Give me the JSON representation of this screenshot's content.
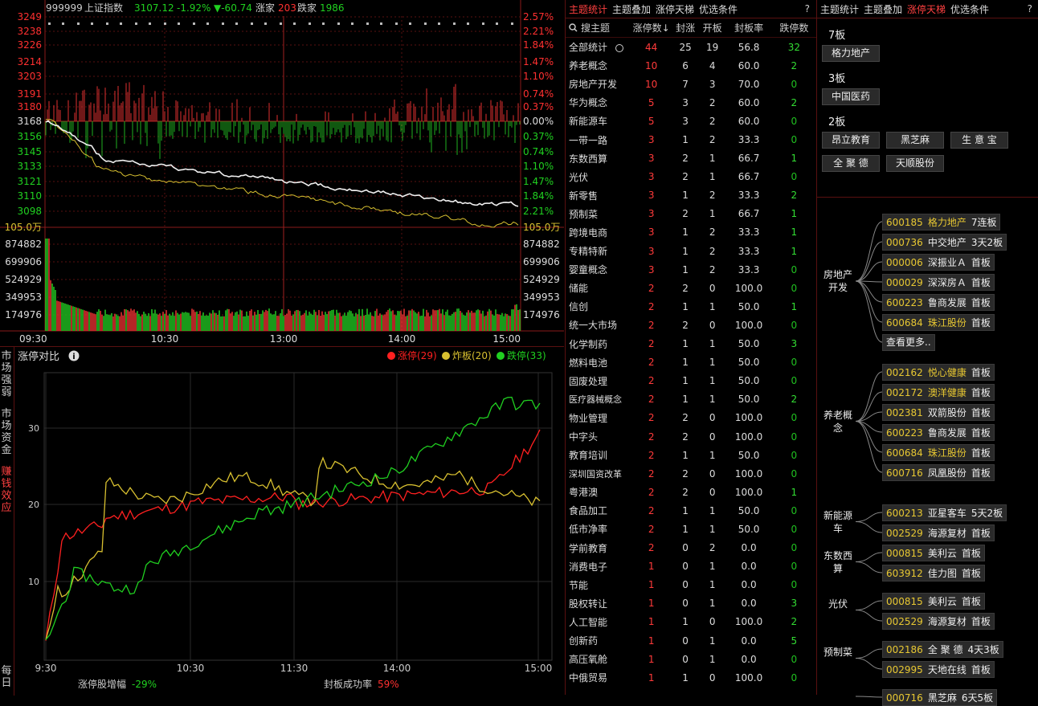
{
  "index_header": {
    "code": "999999",
    "name": "上证指数",
    "price": "3107.12",
    "pct": "-1.92%",
    "change": "▼-60.74",
    "up_label": "涨家",
    "up_count": "203",
    "down_label": "跌家",
    "down_count": "1986"
  },
  "price_axis": {
    "left": [
      "3249",
      "3238",
      "3226",
      "3214",
      "3203",
      "3191",
      "3180",
      "3168",
      "3156",
      "3145",
      "3133",
      "3121",
      "3110",
      "3098"
    ],
    "right": [
      "2.57%",
      "2.21%",
      "1.84%",
      "1.47%",
      "1.10%",
      "0.74%",
      "0.37%",
      "0.00%",
      "0.37%",
      "0.74%",
      "1.10%",
      "1.47%",
      "1.84%",
      "2.21%"
    ]
  },
  "volume_axis": {
    "unit": "105.0万",
    "left": [
      "874882",
      "699906",
      "524929",
      "349953",
      "174976"
    ],
    "right": [
      "874882",
      "699906",
      "524929",
      "349953",
      "174976"
    ]
  },
  "time_axis": [
    "09:30",
    "10:30",
    "13:00",
    "14:00",
    "15:00"
  ],
  "compare": {
    "title": "涨停对比",
    "legend": [
      {
        "label": "涨停(29)",
        "color": "#ff2020"
      },
      {
        "label": "炸板(20)",
        "color": "#d8c030"
      },
      {
        "label": "跌停(33)",
        "color": "#20d020"
      }
    ],
    "y_ticks": [
      "30",
      "20",
      "10"
    ],
    "x_ticks": [
      "9:30",
      "10:30",
      "11:30",
      "14:00",
      "15:00"
    ],
    "footer_left_label": "涨停股增幅",
    "footer_left_value": "-29%",
    "footer_right_label": "封板成功率",
    "footer_right_value": "59%"
  },
  "side_tabs": [
    {
      "label": "市场强弱",
      "color": "#ccc"
    },
    {
      "label": "市场资金",
      "color": "#ccc"
    },
    {
      "label": "赚钱效应",
      "color": "#ff4040"
    },
    {
      "label": "每日",
      "color": "#ccc"
    }
  ],
  "mid": {
    "tabs": [
      {
        "label": "主题统计",
        "active": true
      },
      {
        "label": "主题叠加",
        "active": false
      },
      {
        "label": "涨停天梯",
        "active": false
      },
      {
        "label": "优选条件",
        "active": false
      }
    ],
    "help": "?",
    "search_label": "搜主题",
    "headers": [
      "涨停数↓",
      "封涨",
      "开板",
      "封板率",
      "跌停数"
    ],
    "rows": [
      [
        "全部统计",
        "44",
        "25",
        "19",
        "56.8",
        "32"
      ],
      [
        "养老概念",
        "10",
        "6",
        "4",
        "60.0",
        "2"
      ],
      [
        "房地产开发",
        "10",
        "7",
        "3",
        "70.0",
        "0"
      ],
      [
        "华为概念",
        "5",
        "3",
        "2",
        "60.0",
        "2"
      ],
      [
        "新能源车",
        "5",
        "3",
        "2",
        "60.0",
        "0"
      ],
      [
        "一带一路",
        "3",
        "1",
        "2",
        "33.3",
        "0"
      ],
      [
        "东数西算",
        "3",
        "2",
        "1",
        "66.7",
        "1"
      ],
      [
        "光伏",
        "3",
        "2",
        "1",
        "66.7",
        "0"
      ],
      [
        "新零售",
        "3",
        "1",
        "2",
        "33.3",
        "2"
      ],
      [
        "预制菜",
        "3",
        "2",
        "1",
        "66.7",
        "1"
      ],
      [
        "跨境电商",
        "3",
        "1",
        "2",
        "33.3",
        "1"
      ],
      [
        "专精特新",
        "3",
        "1",
        "2",
        "33.3",
        "1"
      ],
      [
        "婴童概念",
        "3",
        "1",
        "2",
        "33.3",
        "0"
      ],
      [
        "储能",
        "2",
        "2",
        "0",
        "100.0",
        "0"
      ],
      [
        "信创",
        "2",
        "1",
        "1",
        "50.0",
        "1"
      ],
      [
        "统一大市场",
        "2",
        "2",
        "0",
        "100.0",
        "0"
      ],
      [
        "化学制药",
        "2",
        "1",
        "1",
        "50.0",
        "3"
      ],
      [
        "燃料电池",
        "2",
        "1",
        "1",
        "50.0",
        "0"
      ],
      [
        "固废处理",
        "2",
        "1",
        "1",
        "50.0",
        "0"
      ],
      [
        "医疗器械概念",
        "2",
        "1",
        "1",
        "50.0",
        "2"
      ],
      [
        "物业管理",
        "2",
        "2",
        "0",
        "100.0",
        "0"
      ],
      [
        "中字头",
        "2",
        "2",
        "0",
        "100.0",
        "0"
      ],
      [
        "教育培训",
        "2",
        "1",
        "1",
        "50.0",
        "0"
      ],
      [
        "深圳国资改革",
        "2",
        "2",
        "0",
        "100.0",
        "0"
      ],
      [
        "粤港澳",
        "2",
        "2",
        "0",
        "100.0",
        "1"
      ],
      [
        "食品加工",
        "2",
        "1",
        "1",
        "50.0",
        "0"
      ],
      [
        "低市净率",
        "2",
        "1",
        "1",
        "50.0",
        "0"
      ],
      [
        "学前教育",
        "2",
        "0",
        "2",
        "0.0",
        "0"
      ],
      [
        "消费电子",
        "1",
        "0",
        "1",
        "0.0",
        "0"
      ],
      [
        "节能",
        "1",
        "0",
        "1",
        "0.0",
        "0"
      ],
      [
        "股权转让",
        "1",
        "0",
        "1",
        "0.0",
        "3"
      ],
      [
        "人工智能",
        "1",
        "1",
        "0",
        "100.0",
        "2"
      ],
      [
        "创新药",
        "1",
        "0",
        "1",
        "0.0",
        "5"
      ],
      [
        "高压氧舱",
        "1",
        "0",
        "1",
        "0.0",
        "0"
      ],
      [
        "中俄贸易",
        "1",
        "1",
        "0",
        "100.0",
        "0"
      ]
    ]
  },
  "right": {
    "tabs": [
      {
        "label": "主题统计",
        "active": false
      },
      {
        "label": "主题叠加",
        "active": false
      },
      {
        "label": "涨停天梯",
        "active": true
      },
      {
        "label": "优选条件",
        "active": false
      }
    ],
    "help": "?",
    "ladder": [
      {
        "title": "7板",
        "stocks": [
          "格力地产"
        ]
      },
      {
        "title": "3板",
        "stocks": [
          "中国医药"
        ]
      },
      {
        "title": "2板",
        "stocks": [
          "昂立教育",
          "黑芝麻",
          "生 意 宝",
          "全 聚 德",
          "天顺股份"
        ]
      }
    ],
    "groups": [
      {
        "label": "房地产开发",
        "items": [
          [
            "600185",
            "格力地产",
            "7连板",
            true
          ],
          [
            "000736",
            "中交地产",
            "3天2板",
            false
          ],
          [
            "000006",
            "深振业Ａ",
            "首板",
            false
          ],
          [
            "000029",
            "深深房Ａ",
            "首板",
            false
          ],
          [
            "600223",
            "鲁商发展",
            "首板",
            false
          ],
          [
            "600684",
            "珠江股份",
            "首板",
            true
          ]
        ],
        "more": "查看更多.."
      },
      {
        "label": "养老概念",
        "items": [
          [
            "002162",
            "悦心健康",
            "首板",
            true
          ],
          [
            "002172",
            "澳洋健康",
            "首板",
            true
          ],
          [
            "002381",
            "双箭股份",
            "首板",
            false
          ],
          [
            "600223",
            "鲁商发展",
            "首板",
            false
          ],
          [
            "600684",
            "珠江股份",
            "首板",
            true
          ],
          [
            "600716",
            "凤凰股份",
            "首板",
            false
          ]
        ]
      },
      {
        "label": "新能源车",
        "items": [
          [
            "600213",
            "亚星客车",
            "5天2板",
            false
          ],
          [
            "002529",
            "海源复材",
            "首板",
            false
          ]
        ]
      },
      {
        "label": "东数西算",
        "items": [
          [
            "000815",
            "美利云",
            "首板",
            false
          ],
          [
            "603912",
            "佳力图",
            "首板",
            false
          ]
        ]
      },
      {
        "label": "光伏",
        "items": [
          [
            "000815",
            "美利云",
            "首板",
            false
          ],
          [
            "002529",
            "海源复材",
            "首板",
            false
          ]
        ]
      },
      {
        "label": "预制菜",
        "items": [
          [
            "002186",
            "全 聚 德",
            "4天3板",
            false
          ],
          [
            "002995",
            "天地在线",
            "首板",
            false
          ]
        ]
      },
      {
        "label": "",
        "items": [
          [
            "000716",
            "黑芝麻",
            "6天5板",
            false
          ]
        ]
      }
    ]
  }
}
